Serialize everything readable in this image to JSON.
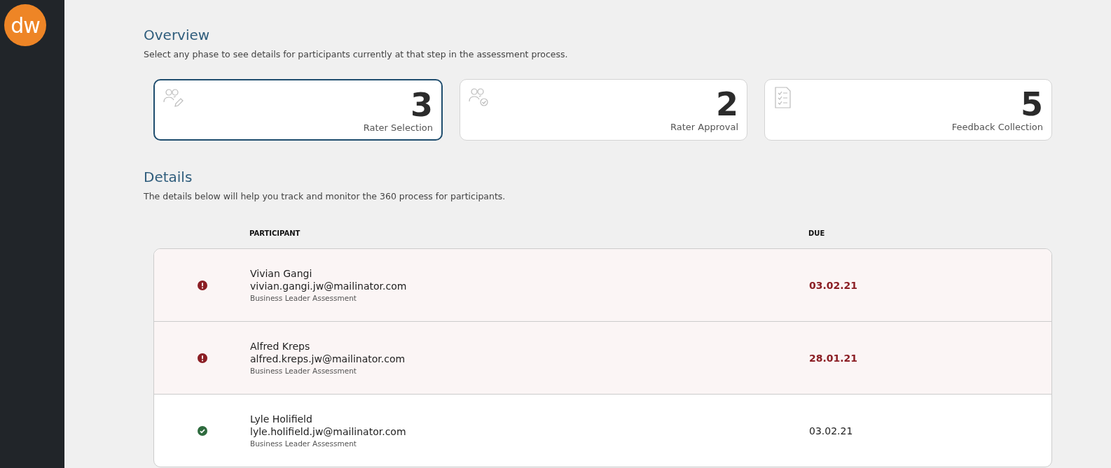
{
  "logo": {
    "text": "dw"
  },
  "overview": {
    "title": "Overview",
    "description": "Select any phase to see details for participants currently at that step in the assessment process.",
    "phases": [
      {
        "kind": "selection",
        "count": "3",
        "label": "Rater Selection",
        "selected": true
      },
      {
        "kind": "approval",
        "count": "2",
        "label": "Rater Approval",
        "selected": false
      },
      {
        "kind": "feedback",
        "count": "5",
        "label": "Feedback Collection",
        "selected": false
      }
    ]
  },
  "details": {
    "title": "Details",
    "description": "The details below will help you track and monitor the 360 process for participants.",
    "columns": [
      "PARTICIPANT",
      "DUE"
    ],
    "rows": [
      {
        "overdue": true,
        "name": "Vivian Gangi",
        "email": "vivian.gangi.jw@mailinator.com",
        "assessment": "Business Leader Assessment",
        "due": "03.02.21"
      },
      {
        "overdue": true,
        "name": "Alfred Kreps",
        "email": "alfred.kreps.jw@mailinator.com",
        "assessment": "Business Leader Assessment",
        "due": "28.01.21"
      },
      {
        "overdue": false,
        "name": "Lyle Holifield",
        "email": "lyle.holifield.jw@mailinator.com",
        "assessment": "Business Leader Assessment",
        "due": "03.02.21"
      }
    ]
  }
}
